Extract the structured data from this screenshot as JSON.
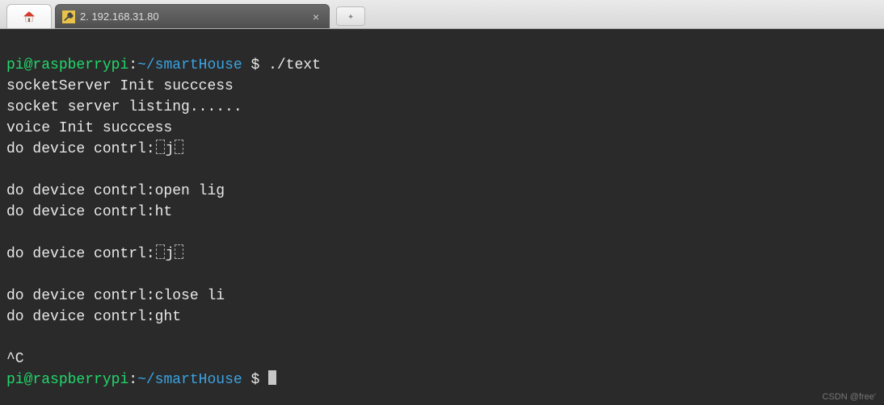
{
  "tabs": {
    "active_title": "2. 192.168.31.80",
    "new_tab_glyph": "✦"
  },
  "prompt1": {
    "user": "pi",
    "at": "@",
    "host": "raspberrypi",
    "colon": ":",
    "path": "~/smartHouse",
    "dollar": " $ ",
    "cmd": "./text"
  },
  "lines": {
    "l1": "socketServer Init succcess",
    "l2": "socket server listing......",
    "l3": "voice Init succcess",
    "l4a": "do device contrl:",
    "l4b": "j",
    "l5": "",
    "l6": "do device contrl:open lig",
    "l7": "do device contrl:ht",
    "l8": "",
    "l9a": "do device contrl:",
    "l9b": "j",
    "l10": "",
    "l11": "do device contrl:close li",
    "l12": "do device contrl:ght",
    "l13": "",
    "l14": "^C"
  },
  "prompt2": {
    "user": "pi",
    "at": "@",
    "host": "raspberrypi",
    "colon": ":",
    "path": "~/smartHouse",
    "dollar": " $ "
  },
  "watermark": "CSDN @free'"
}
